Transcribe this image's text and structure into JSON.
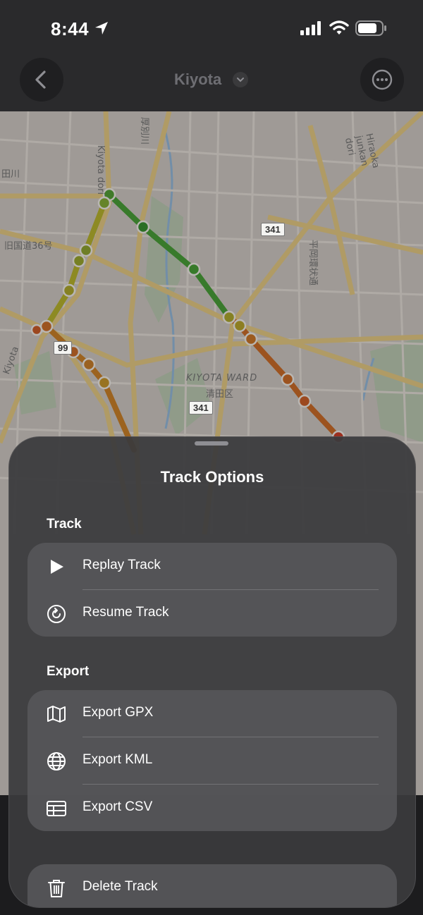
{
  "status_bar": {
    "time": "8:44"
  },
  "nav": {
    "title": "Kiyota"
  },
  "map": {
    "labels": {
      "street_kiyota_dori": "Kiyota dori",
      "street_kyu_kokudo": "旧国道36号",
      "street_hiraoka": "Hiraoka junkan dori",
      "street_hiraoka_jp": "平岡環状通",
      "ward_en": "KIYOTA WARD",
      "ward_jp": "清田区",
      "street_kiyota_left": "Kiyota",
      "river": "厚別川",
      "road_left_top": "田川"
    },
    "shields": {
      "route_341_a": "341",
      "route_341_b": "341",
      "route_99": "99"
    }
  },
  "sheet": {
    "title": "Track Options",
    "sections": {
      "track": {
        "title": "Track",
        "items": [
          {
            "label": "Replay Track",
            "icon": "play-icon"
          },
          {
            "label": "Resume Track",
            "icon": "resume-icon"
          }
        ]
      },
      "export": {
        "title": "Export",
        "items": [
          {
            "label": "Export GPX",
            "icon": "map-icon"
          },
          {
            "label": "Export KML",
            "icon": "globe-icon"
          },
          {
            "label": "Export CSV",
            "icon": "table-icon"
          }
        ]
      },
      "danger": {
        "items": [
          {
            "label": "Delete Track",
            "icon": "trash-icon"
          }
        ]
      }
    }
  }
}
